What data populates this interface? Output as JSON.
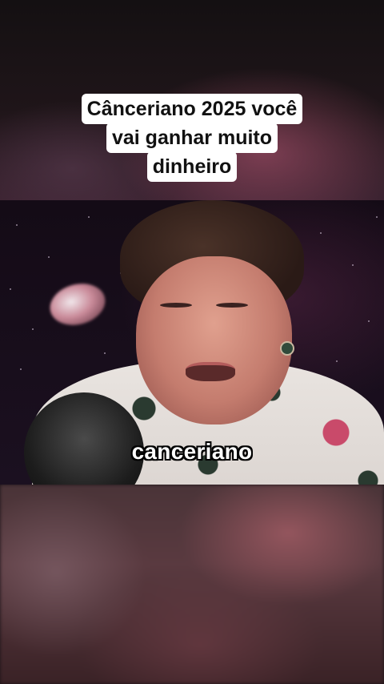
{
  "title_caption": {
    "lines": [
      "Cânceriano 2025 você",
      "vai ganhar muito",
      "dinheiro"
    ]
  },
  "subtitle": {
    "text": "canceriano"
  },
  "colors": {
    "caption_background": "#ffffff",
    "caption_text": "#111111",
    "subtitle_text": "#ffffff",
    "subtitle_outline": "#000000"
  }
}
